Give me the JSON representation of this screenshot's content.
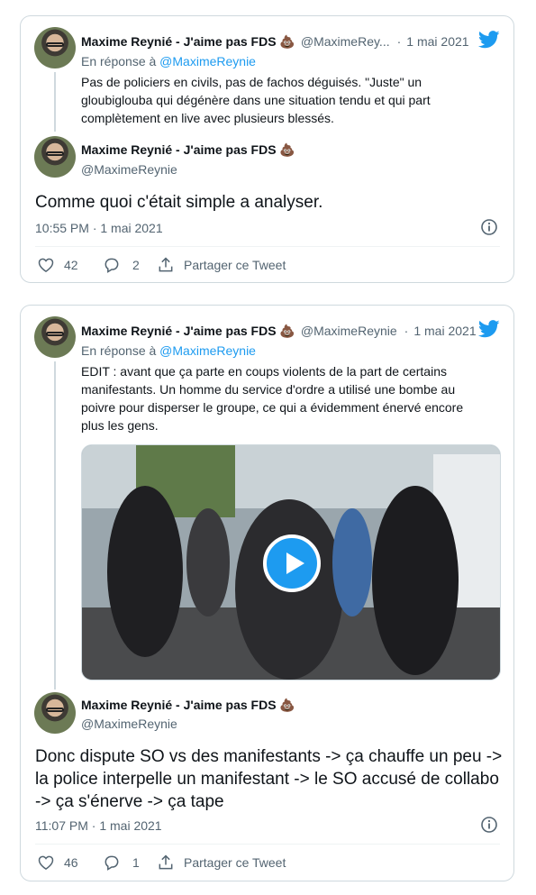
{
  "colors": {
    "accent": "#1d9bf0",
    "text": "#0f1419",
    "muted": "#536471",
    "border": "#cfd9de"
  },
  "tweet1": {
    "parent": {
      "name": "Maxime Reynié - J'aime pas FDS 💩",
      "handle": "@MaximeRey...",
      "sep": "·",
      "date": "1 mai 2021",
      "reply_prefix": "En réponse à ",
      "reply_handle": "@MaximeReynie",
      "text": "Pas de policiers en civils, pas de fachos déguisés. \"Juste\" un gloubiglouba qui dégénère dans une situation tendu et qui part complètement en live avec plusieurs blessés."
    },
    "main": {
      "name": "Maxime Reynié - J'aime pas FDS 💩",
      "handle": "@MaximeReynie",
      "text": "Comme quoi c'était simple a analyser.",
      "timestamp": "10:55 PM · 1 mai 2021"
    },
    "actions": {
      "likes": "42",
      "replies": "2",
      "share": "Partager ce Tweet"
    }
  },
  "tweet2": {
    "parent": {
      "name": "Maxime Reynié - J'aime pas FDS 💩",
      "handle": "@MaximeReynie",
      "sep": "·",
      "date": "1 mai 2021",
      "reply_prefix": "En réponse à ",
      "reply_handle": "@MaximeReynie",
      "text": "EDIT : avant que ça parte en coups violents de la part de certains manifestants. Un homme du service d'ordre a utilisé une bombe au poivre pour disperser le groupe, ce qui a évidemment énervé encore plus les gens."
    },
    "main": {
      "name": "Maxime Reynié - J'aime pas FDS 💩",
      "handle": "@MaximeReynie",
      "text": "Donc dispute SO vs des manifestants ->  ça chauffe un peu -> la police interpelle un manifestant -> le SO accusé de collabo -> ça s'énerve -> ça tape",
      "timestamp": "11:07 PM · 1 mai 2021"
    },
    "actions": {
      "likes": "46",
      "replies": "1",
      "share": "Partager ce Tweet"
    }
  },
  "icons": {
    "bird": "twitter-bird-icon",
    "info": "info-icon",
    "like": "heart-icon",
    "reply": "reply-bubble-icon",
    "share": "share-icon",
    "play": "play-icon"
  }
}
